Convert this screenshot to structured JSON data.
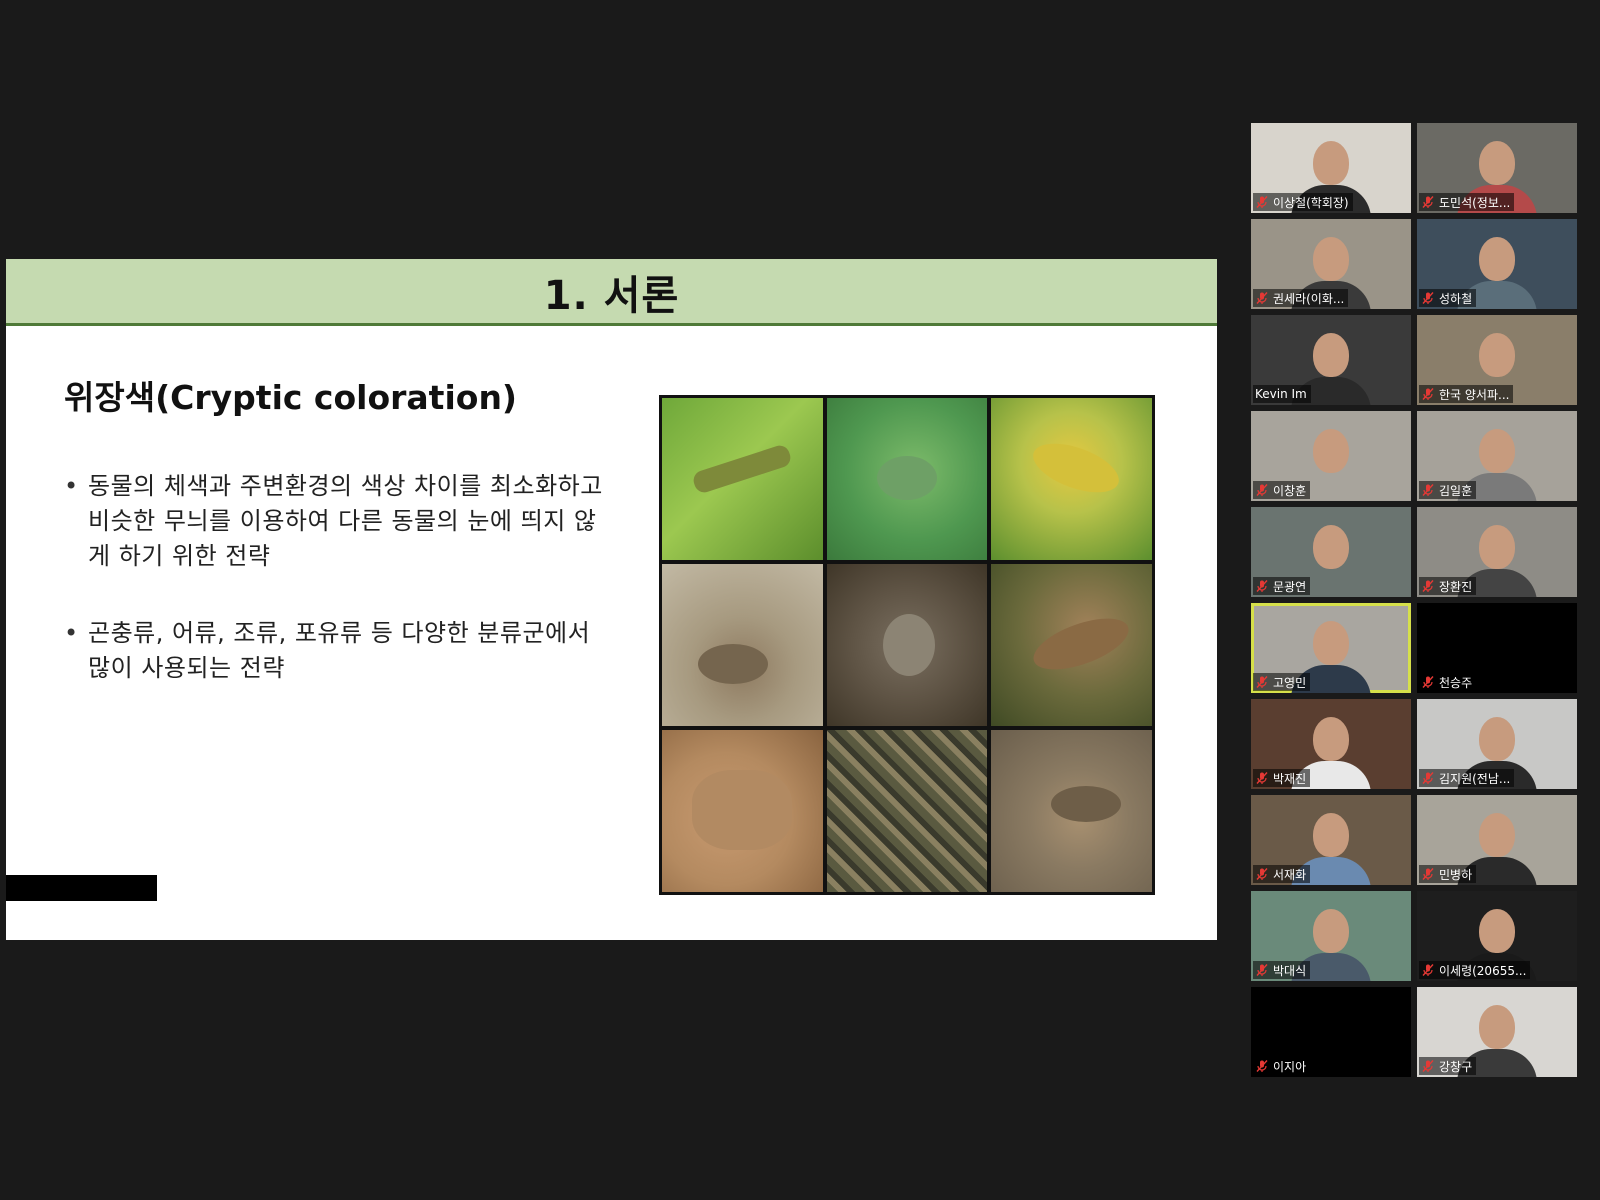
{
  "slide": {
    "title": "1. 서론",
    "subtitle": "위장색(Cryptic coloration)",
    "bullets": [
      "동물의 체색과 주변환경의 색상 차이를 최소화하고 비슷한 무늬를 이용하여 다른 동물의 눈에 띄지 않게 하기 위한 전략",
      "곤충류, 어류, 조류, 포유류 등 다양한 분류군에서 많이 사용되는 전략"
    ],
    "header_color": "#c5dab0",
    "header_rule_color": "#4f7a38"
  },
  "participants": [
    {
      "name": "이상철(학회장)",
      "muted": true
    },
    {
      "name": "도민석(정보...",
      "muted": true
    },
    {
      "name": "권세라(이화...",
      "muted": true
    },
    {
      "name": "성하철",
      "muted": true
    },
    {
      "name": "Kevin Im",
      "muted": false
    },
    {
      "name": "한국 양서파...",
      "muted": true
    },
    {
      "name": "이창훈",
      "muted": true
    },
    {
      "name": "김일훈",
      "muted": true
    },
    {
      "name": "문광연",
      "muted": true
    },
    {
      "name": "장환진",
      "muted": true
    },
    {
      "name": "고영민",
      "muted": true,
      "active_speaker": true
    },
    {
      "name": "천승주",
      "muted": true
    },
    {
      "name": "박재진",
      "muted": true
    },
    {
      "name": "김지원(전남...",
      "muted": true
    },
    {
      "name": "서재화",
      "muted": true
    },
    {
      "name": "민병하",
      "muted": true
    },
    {
      "name": "박대식",
      "muted": true
    },
    {
      "name": "이세령(20655...",
      "muted": true
    },
    {
      "name": "이지아",
      "muted": true
    },
    {
      "name": "강창구",
      "muted": true
    }
  ],
  "colors": {
    "background": "#1a1a1a",
    "active_speaker_border": "#d6e04a",
    "muted_mic": "#e53935"
  },
  "icons": {
    "muted": "microphone-muted-icon"
  }
}
